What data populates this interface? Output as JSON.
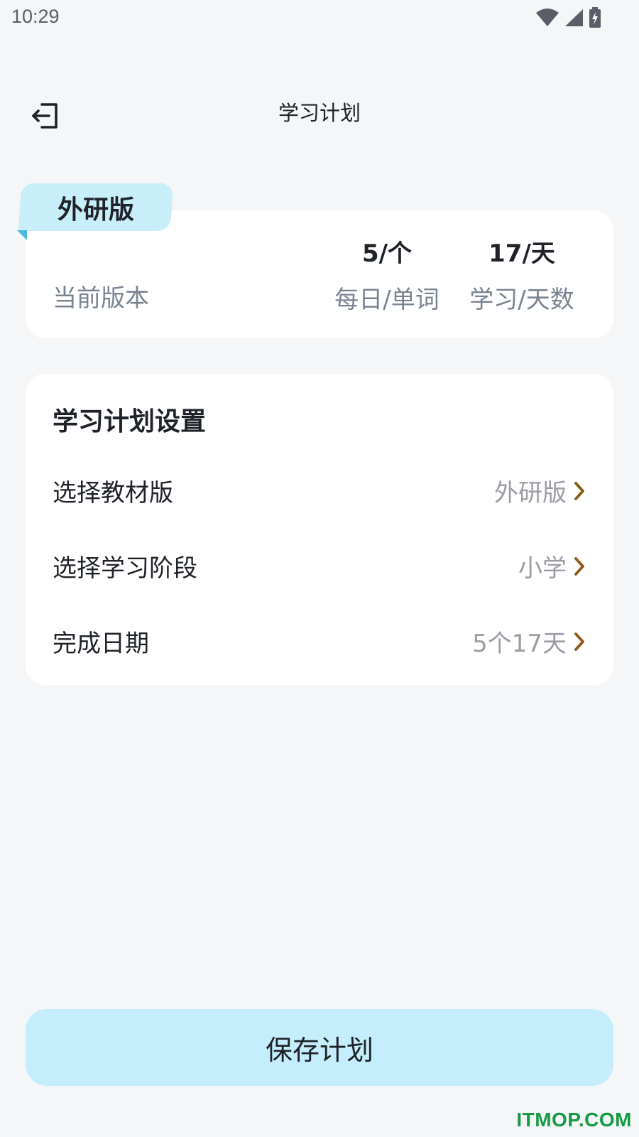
{
  "status_bar": {
    "time": "10:29",
    "icons": [
      "wifi-icon",
      "signal-icon",
      "battery-charging-icon"
    ]
  },
  "header": {
    "back_icon": "exit-icon",
    "title": "学习计划"
  },
  "version_card": {
    "tab_label": "外研版",
    "current_label": "当前版本",
    "daily_value": "5/个",
    "daily_label": "每日/单词",
    "days_value": "17/天",
    "days_label": "学习/天数"
  },
  "settings": {
    "title": "学习计划设置",
    "rows": [
      {
        "label": "选择教材版",
        "value": "外研版"
      },
      {
        "label": "选择学习阶段",
        "value": "小学"
      },
      {
        "label": "完成日期",
        "value": "5个17天"
      }
    ]
  },
  "save_button": "保存计划",
  "watermark": "ITMOP.COM",
  "colors": {
    "background": "#f5f6f8",
    "accent_light_blue": "#c4eefb",
    "chevron_brown": "#8a5a12",
    "watermark_green": "#149b44"
  }
}
